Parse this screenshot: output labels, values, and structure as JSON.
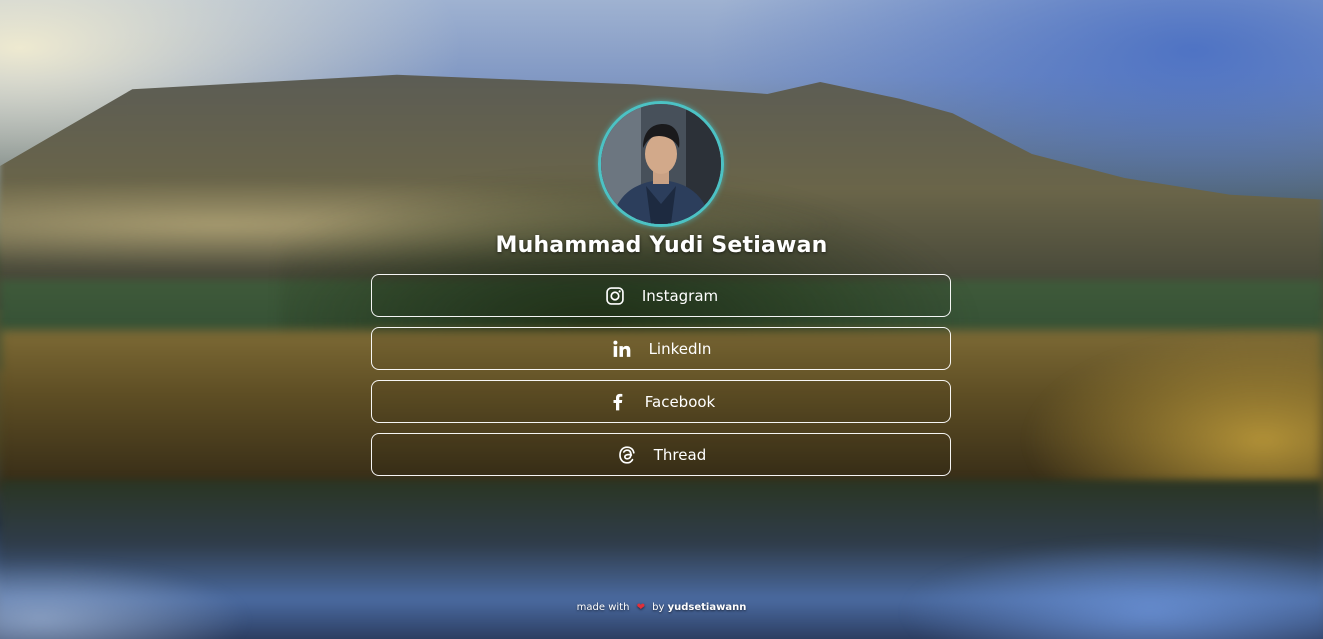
{
  "profile": {
    "name": "Muhammad Yudi Setiawan"
  },
  "links": [
    {
      "label": "Instagram",
      "icon": "instagram-icon"
    },
    {
      "label": "LinkedIn",
      "icon": "linkedin-icon"
    },
    {
      "label": "Facebook",
      "icon": "facebook-icon"
    },
    {
      "label": "Thread",
      "icon": "threads-icon"
    }
  ],
  "footer": {
    "made_with": "made with",
    "heart": "❤",
    "by": "by",
    "author": "yudsetiawann"
  },
  "colors": {
    "avatar_ring": "#4cc2c4",
    "text": "#ffffff",
    "heart": "#e0303a"
  }
}
